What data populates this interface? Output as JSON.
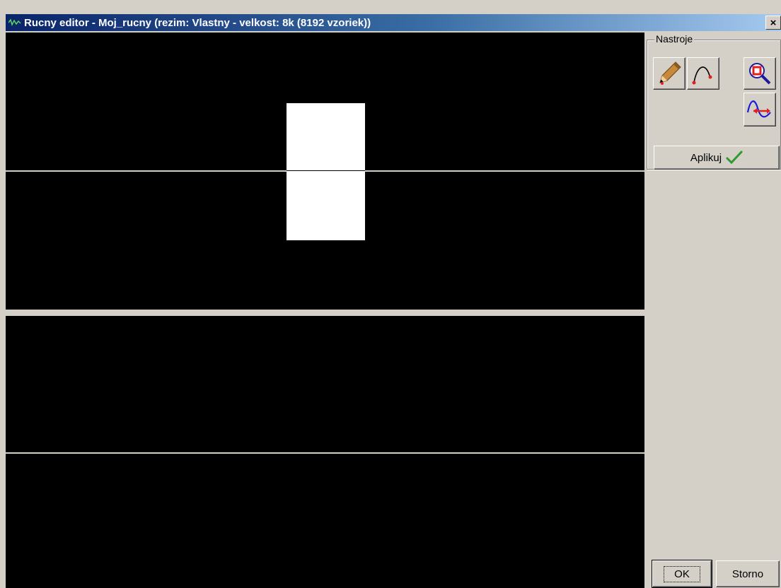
{
  "window": {
    "title": "Rucny editor - Moj_rucny (rezim: Vlastny - velkost: 8k (8192 vzoriek))",
    "close_label": "×"
  },
  "tools": {
    "group_label": "Nastroje",
    "items": [
      {
        "name": "pencil-tool",
        "icon": "pencil-icon"
      },
      {
        "name": "curve-tool",
        "icon": "curve-icon"
      },
      {
        "name": "zoom-tool",
        "icon": "zoom-icon"
      },
      {
        "name": "shift-tool",
        "icon": "wave-shift-icon"
      }
    ],
    "apply_label": "Aplikuj"
  },
  "buttons": {
    "ok_label": "OK",
    "cancel_label": "Storno"
  },
  "colors": {
    "background": "#d4d0c8",
    "canvas": "#000000",
    "waveform": "#ffffff",
    "titlebar_start": "#0a246a",
    "titlebar_end": "#a6caf0",
    "checkmark": "#2e9a2e"
  }
}
